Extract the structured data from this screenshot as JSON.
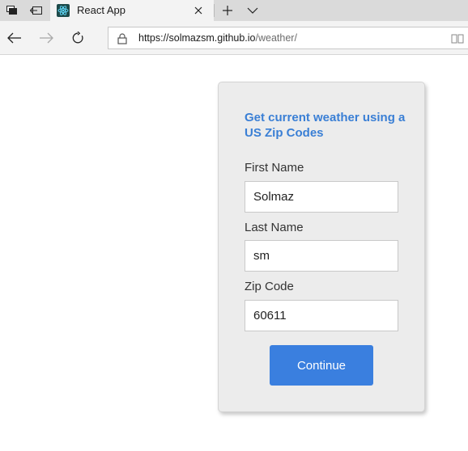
{
  "browser": {
    "tab": {
      "title": "React App"
    },
    "address": {
      "origin": "https://solmazsm.github.io",
      "path": "/weather/"
    }
  },
  "form": {
    "title": "Get current weather using a US Zip Codes",
    "fields": [
      {
        "label": "First Name",
        "value": "Solmaz"
      },
      {
        "label": "Last Name",
        "value": "sm"
      },
      {
        "label": "Zip Code",
        "value": "60611"
      }
    ],
    "submit_label": "Continue"
  },
  "colors": {
    "accent": "#3a7fdf",
    "title": "#3a7fd5",
    "card_bg": "#ececec"
  },
  "icons": {
    "tab_preview": "tab-preview-icon",
    "set_aside": "set-aside-tabs-icon",
    "favicon": "react-favicon-icon",
    "close": "close-icon",
    "new_tab": "plus-icon",
    "tab_list": "chevron-down-icon",
    "back": "back-arrow-icon",
    "forward": "forward-arrow-icon",
    "refresh": "refresh-icon",
    "lock": "lock-icon",
    "reading_view": "reading-view-icon"
  }
}
